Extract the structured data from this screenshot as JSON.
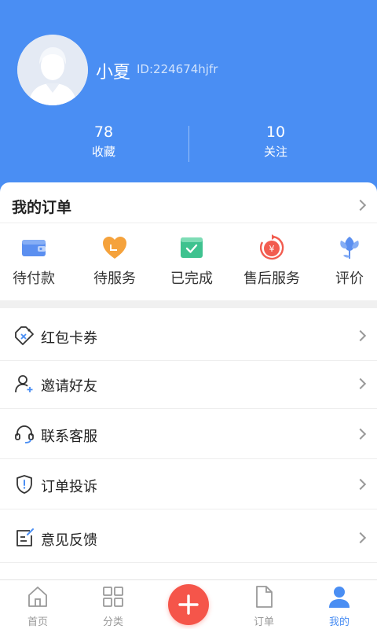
{
  "profile": {
    "name": "小夏",
    "id_text": "ID:224674hjfr"
  },
  "stats": [
    {
      "value": "78",
      "label": "收藏"
    },
    {
      "value": "10",
      "label": "关注"
    }
  ],
  "orders": {
    "title": "我的订单",
    "items": [
      {
        "label": "待付款",
        "icon": "wallet-icon"
      },
      {
        "label": "待服务",
        "icon": "heart-box-icon"
      },
      {
        "label": "已完成",
        "icon": "check-box-icon"
      },
      {
        "label": "售后服务",
        "icon": "refund-icon"
      },
      {
        "label": "评价",
        "icon": "flower-icon"
      }
    ]
  },
  "menu": [
    {
      "label": "红包卡券",
      "icon": "coupon-icon"
    },
    {
      "label": "邀请好友",
      "icon": "add-user-icon"
    },
    {
      "label": "联系客服",
      "icon": "headset-icon"
    },
    {
      "label": "订单投诉",
      "icon": "shield-alert-icon"
    },
    {
      "label": "意见反馈",
      "icon": "feedback-icon"
    }
  ],
  "tabbar": [
    {
      "label": "首页",
      "icon": "home-icon"
    },
    {
      "label": "分类",
      "icon": "grid-icon"
    },
    {
      "label": "",
      "icon": "plus-icon"
    },
    {
      "label": "订单",
      "icon": "document-icon"
    },
    {
      "label": "我的",
      "icon": "user-icon"
    }
  ],
  "colors": {
    "primary": "#4a8ef3",
    "fab": "#f5554a",
    "orange": "#f5a23c",
    "green": "#3ec28f",
    "red": "#f25c4f"
  }
}
